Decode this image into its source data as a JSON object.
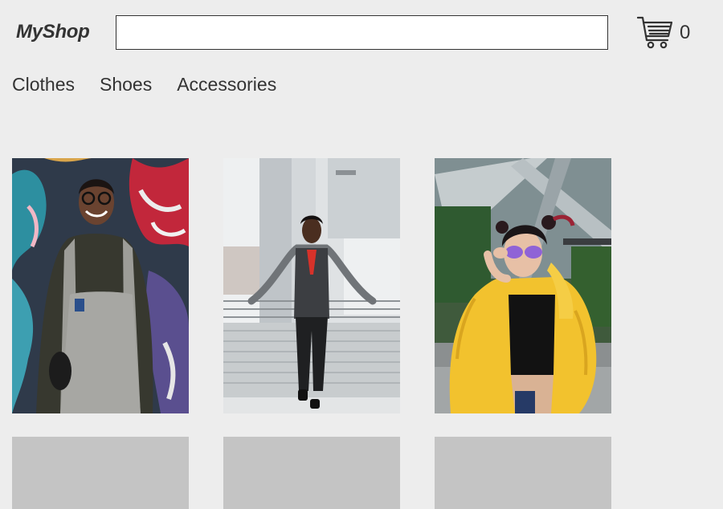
{
  "header": {
    "logo": "MyShop",
    "search": {
      "value": "",
      "placeholder": ""
    },
    "cart": {
      "icon": "cart-icon",
      "count": "0"
    }
  },
  "nav": {
    "items": [
      {
        "label": "Clothes"
      },
      {
        "label": "Shoes"
      },
      {
        "label": "Accessories"
      }
    ]
  },
  "products": {
    "row1": [
      {
        "image": "man-in-gray-overalls-in-front-of-graffiti-wall"
      },
      {
        "image": "man-in-vest-and-red-tie-leaning-on-railing"
      },
      {
        "image": "woman-in-yellow-puffer-jacket-and-purple-glasses"
      }
    ],
    "row2": [
      {
        "image": "placeholder"
      },
      {
        "image": "placeholder"
      },
      {
        "image": "placeholder"
      }
    ]
  },
  "colors": {
    "background": "#ededed",
    "text": "#333333",
    "placeholder": "#c4c4c4",
    "jacket": "#f2c22e"
  }
}
